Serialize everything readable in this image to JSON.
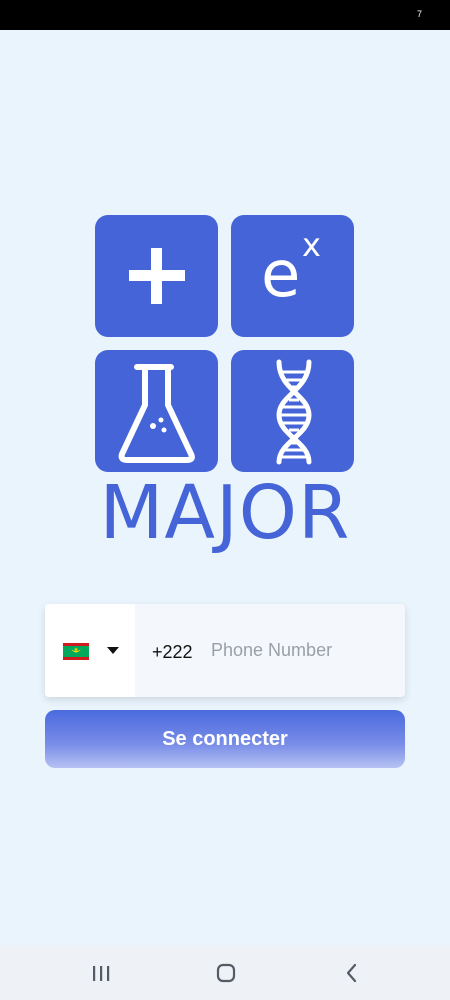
{
  "status_bar": {
    "indicator": "7"
  },
  "logo": {
    "plus_icon": "plus-icon",
    "exponent_base": "e",
    "exponent_power": "x",
    "flask_icon": "flask-icon",
    "dna_icon": "dna-icon",
    "brand_name": "MAJOR",
    "accent_color": "#4464d8"
  },
  "login_form": {
    "country_flag": "mauritania-flag",
    "dial_code": "+222",
    "phone_placeholder": "Phone Number",
    "phone_value": "",
    "submit_label": "Se connecter"
  },
  "nav_bar": {
    "recents_icon": "recents-icon",
    "home_icon": "home-icon",
    "back_icon": "back-icon"
  }
}
